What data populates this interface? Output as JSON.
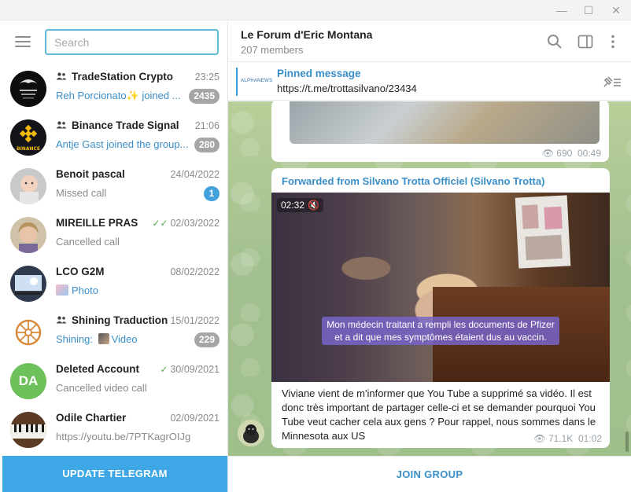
{
  "window": {
    "minimize": "—",
    "maximize": "☐",
    "close": "✕"
  },
  "search": {
    "placeholder": "Search"
  },
  "chats": [
    {
      "name": "TradeStation Crypto",
      "group": true,
      "date": "23:25",
      "preview_sender": "Reh Porcionato✨ joined ...",
      "preview": "",
      "badge": "2435",
      "badge_style": "muted",
      "avatar": "tradestation-avatar"
    },
    {
      "name": "Binance Trade Signal",
      "group": true,
      "date": "21:06",
      "preview_sender": "Antje Gast joined the group...",
      "preview": "",
      "badge": "280",
      "badge_style": "muted",
      "avatar": "binance-avatar"
    },
    {
      "name": "Benoit pascal",
      "group": false,
      "date": "24/04/2022",
      "preview_sender": "",
      "preview": "Missed call",
      "badge": "1",
      "badge_style": "blue",
      "avatar": "baby-avatar"
    },
    {
      "name": "MIREILLE PRAS",
      "group": false,
      "date": "02/03/2022",
      "ticks": "✓✓",
      "preview_sender": "",
      "preview": "Cancelled call",
      "badge": "",
      "avatar": "woman-avatar"
    },
    {
      "name": "LCO G2M",
      "group": false,
      "date": "08/02/2022",
      "preview_sender": "Photo",
      "preview": "",
      "badge": "",
      "avatar": "screen-avatar"
    },
    {
      "name": "Shining Traduction",
      "group": true,
      "date": "15/01/2022",
      "preview_sender": "Shining:",
      "preview_media": "Video",
      "preview": "",
      "badge": "229",
      "badge_style": "muted",
      "avatar": "wheel-avatar"
    },
    {
      "name": "Deleted Account",
      "group": false,
      "date": "30/09/2021",
      "ticks": "✓",
      "preview_sender": "",
      "preview": "Cancelled video call",
      "badge": "",
      "avatar": "da-avatar",
      "initials": "DA"
    },
    {
      "name": "Odile Chartier",
      "group": false,
      "date": "02/09/2021",
      "preview_sender": "",
      "preview": "https://youtu.be/7PTKagrOIJg",
      "badge": "",
      "avatar": "piano-avatar"
    }
  ],
  "update_button": "UPDATE TELEGRAM",
  "header": {
    "title": "Le Forum d'Eric Montana",
    "subtitle": "207 members"
  },
  "pinned": {
    "label": "Pinned message",
    "text": "https://t.me/trottasilvano/23434",
    "thumb_text": "ALPHANEWS"
  },
  "message1": {
    "views": "690",
    "time": "00:49"
  },
  "message2": {
    "forwarded": "Forwarded from Silvano Trotta Officiel (Silvano Trotta)",
    "video_duration": "02:32",
    "subtitle_line1": "Mon médecin traitant a rempli les documents de Pfizer",
    "subtitle_line2": "et a dit que mes symptômes étaient dus au vaccin.",
    "text": "Viviane vient de m'informer que You Tube a supprimé sa vidéo. Il est donc très important de partager celle-ci et se demander pourquoi You Tube veut cacher cela aux gens ? Pour rappel, nous sommes dans le Minnesota aux US",
    "views": "71.1K",
    "time": "01:02"
  },
  "join_button": "JOIN GROUP",
  "colors": {
    "accent": "#3ea8e6",
    "link": "#3a8fc8",
    "muted_badge": "#a5a5a5",
    "search_border": "#5fbbd6"
  }
}
